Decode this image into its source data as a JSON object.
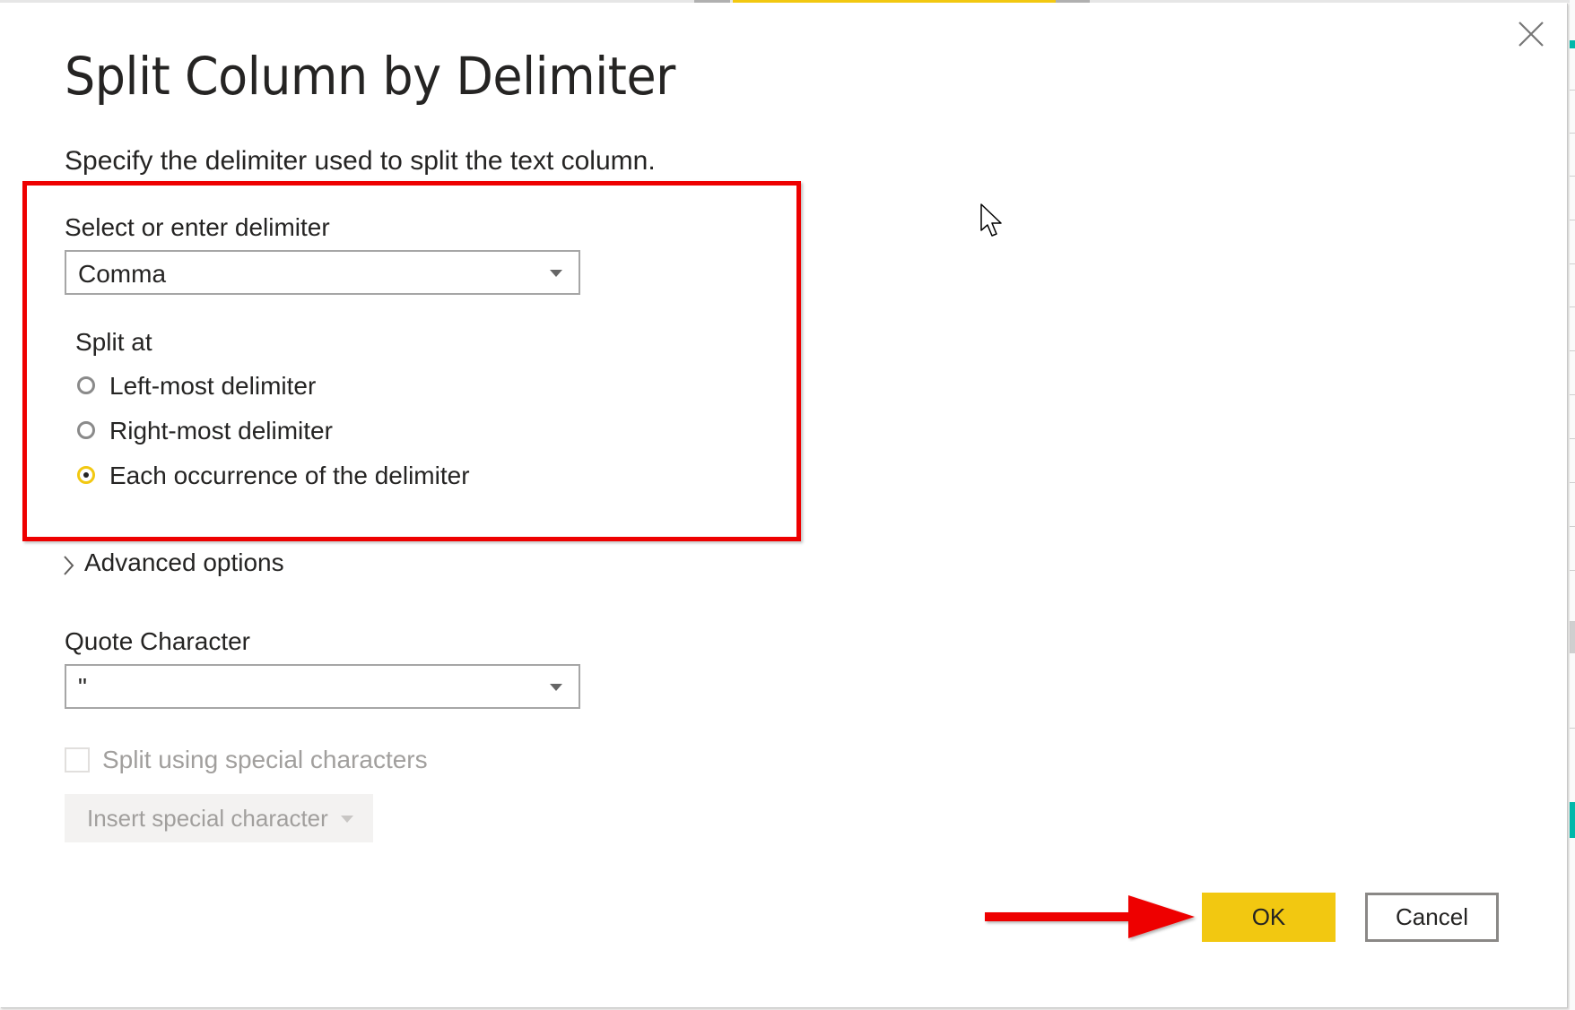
{
  "dialog": {
    "title": "Split Column by Delimiter",
    "subtitle": "Specify the delimiter used to split the text column.",
    "close_icon": "close-icon"
  },
  "delimiter": {
    "label": "Select or enter delimiter",
    "selected": "Comma"
  },
  "split_at": {
    "label": "Split at",
    "options": [
      {
        "label": "Left-most delimiter",
        "checked": false
      },
      {
        "label": "Right-most delimiter",
        "checked": false
      },
      {
        "label": "Each occurrence of the delimiter",
        "checked": true
      }
    ]
  },
  "advanced_options": {
    "label": "Advanced options",
    "expanded": false
  },
  "quote_character": {
    "label": "Quote Character",
    "selected": "\""
  },
  "special_characters": {
    "checkbox_label": "Split using special characters",
    "checked": false,
    "insert_button_label": "Insert special character"
  },
  "buttons": {
    "ok": "OK",
    "cancel": "Cancel"
  },
  "annotations": {
    "highlight_color": "#ee0000",
    "arrow_color": "#ee0000"
  },
  "colors": {
    "accent": "#f2c811",
    "text": "#252423",
    "disabled_text": "#a19f9d"
  }
}
